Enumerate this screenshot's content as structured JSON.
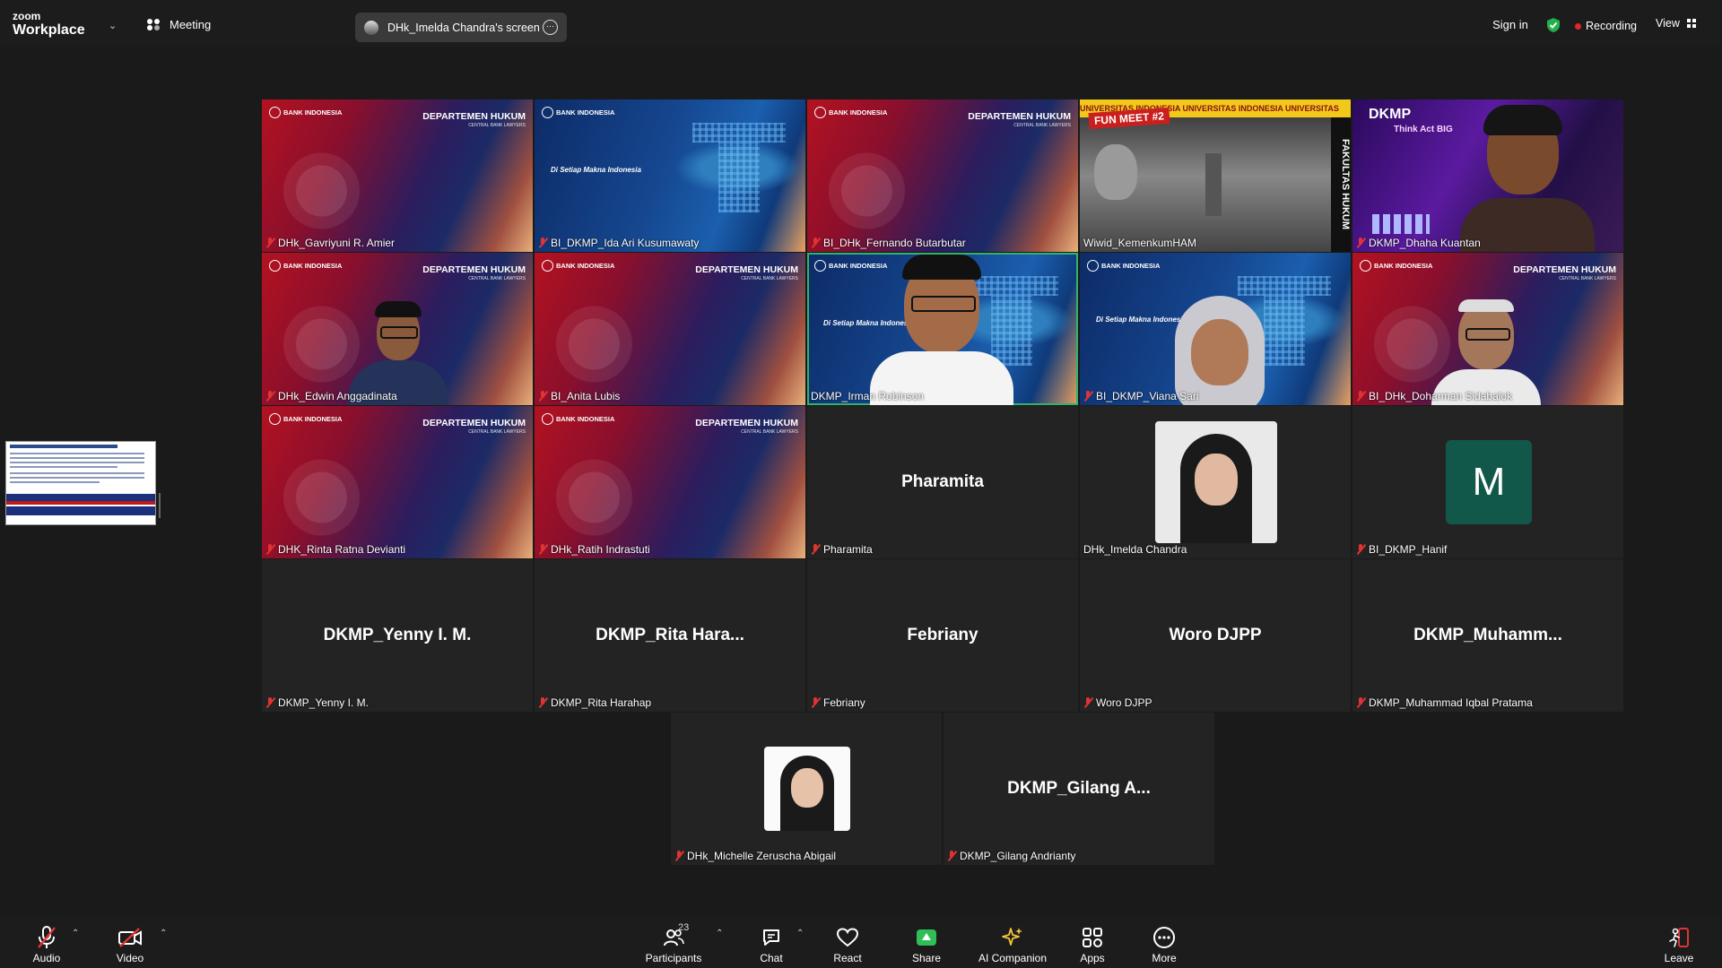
{
  "topbar": {
    "brand_small": "zoom",
    "brand_large": "Workplace",
    "meeting_label": "Meeting",
    "screen_share_label": "DHk_Imelda Chandra's screen",
    "sign_in": "Sign in",
    "recording": "Recording",
    "view": "View"
  },
  "colors": {
    "accent_green": "#2fb36e",
    "record_red": "#e02828",
    "avatar_teal": "#12584a"
  },
  "tiles": [
    {
      "name": "DHk_Gavriyuni R. Amier"
    },
    {
      "name": "BI_DKMP_Ida Ari Kusumawaty"
    },
    {
      "name": "BI_DHk_Fernando Butarbutar"
    },
    {
      "name": "Wiwid_KemenkumHAM"
    },
    {
      "name": "DKMP_Dhaha Kuantan"
    },
    {
      "name": "DHk_Edwin Anggadinata"
    },
    {
      "name": "BI_Anita Lubis"
    },
    {
      "name": "DKMP_Irman Robinson"
    },
    {
      "name": "BI_DKMP_Viana Sari"
    },
    {
      "name": "BI_DHk_Doharman Sidabalok"
    },
    {
      "name": "DHK_Rinta Ratna Devianti"
    },
    {
      "name": "DHk_Ratih Indrastuti"
    },
    {
      "name": "Pharamita",
      "display": "Pharamita"
    },
    {
      "name": "DHk_Imelda Chandra"
    },
    {
      "name": "BI_DKMP_Hanif",
      "avatar_letter": "M"
    },
    {
      "name": "DKMP_Yenny I. M.",
      "display": "DKMP_Yenny I. M."
    },
    {
      "name": "DKMP_Rita Harahap",
      "display": "DKMP_Rita Hara..."
    },
    {
      "name": "Febriany",
      "display": "Febriany"
    },
    {
      "name": "Woro DJPP",
      "display": "Woro DJPP"
    },
    {
      "name": "DKMP_Muhammad Iqbal Pratama",
      "display": "DKMP_Muhamm..."
    },
    {
      "name": "DHk_Michelle Zeruscha Abigail"
    },
    {
      "name": "DKMP_Gilang Andrianty",
      "display": "DKMP_Gilang A..."
    }
  ],
  "background_text": {
    "bank": "BANK INDONESIA",
    "dept": "DEPARTEMEN HUKUM",
    "dept_sub": "CENTRAL BANK LAWYERS",
    "slogan": "Di Setiap Makna Indonesia",
    "fun_banner": "UNIVERSITAS INDONESIA UNIVERSITAS INDONESIA UNIVERSITAS",
    "fun_tag": "FUN MEET #2",
    "fun_side": "FAKULTAS HUKUM",
    "dkmp_title": "DKMP",
    "dkmp_sub": "Think Act BIG"
  },
  "toolbar": {
    "audio": "Audio",
    "video": "Video",
    "participants": "Participants",
    "participants_count": "23",
    "chat": "Chat",
    "react": "React",
    "share": "Share",
    "ai_companion": "AI Companion",
    "apps": "Apps",
    "more": "More",
    "leave": "Leave"
  }
}
